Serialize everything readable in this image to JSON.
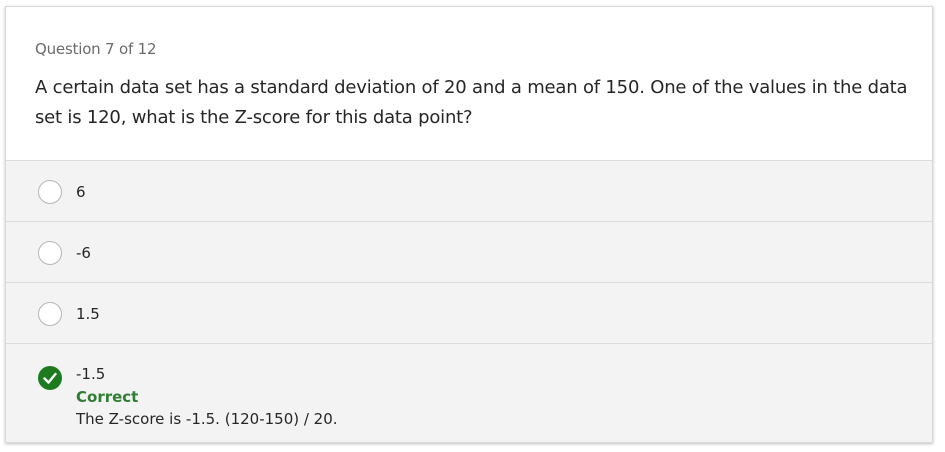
{
  "question": {
    "counter": "Question 7 of 12",
    "text": "A certain data set has a standard deviation of 20 and a mean of 150. One of the values in the data set is 120, what is the Z-score for this data point?"
  },
  "options": [
    {
      "label": "6",
      "state": "unselected"
    },
    {
      "label": "-6",
      "state": "unselected"
    },
    {
      "label": "1.5",
      "state": "unselected"
    },
    {
      "label": "-1.5",
      "state": "selected-correct"
    }
  ],
  "feedback": {
    "status": "Correct",
    "explanation": "The Z-score is -1.5. (120-150) / 20.",
    "icon": "checkmark-icon",
    "color": "#1e7a1e"
  }
}
